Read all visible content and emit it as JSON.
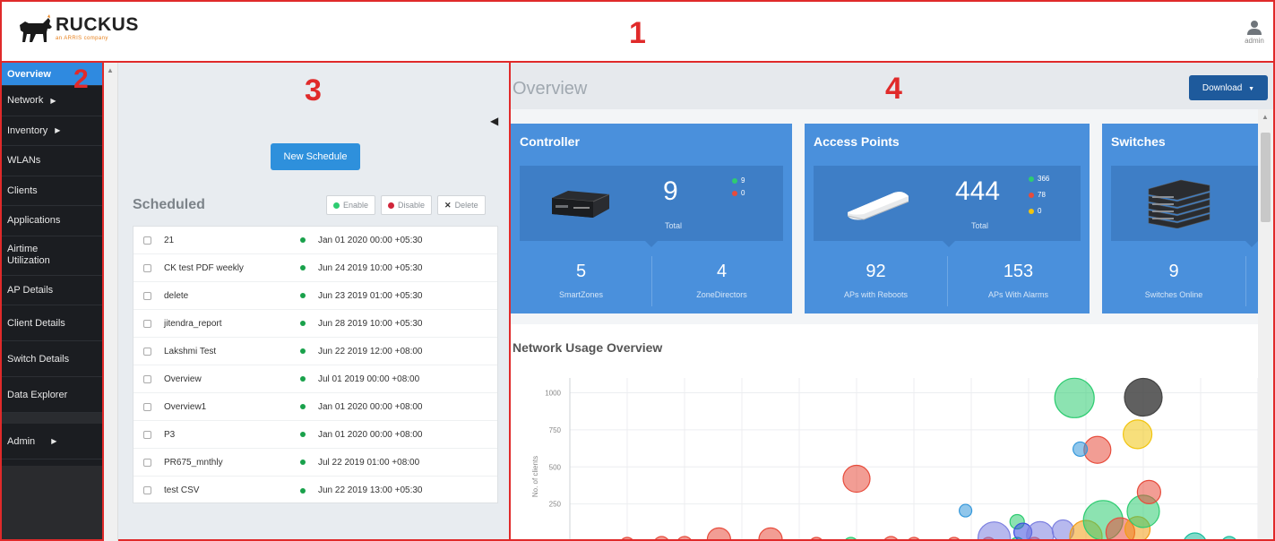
{
  "header": {
    "brand": "RUCKUS",
    "brand_sub": "an ARRIS company",
    "region_label": "1",
    "user_label": "admin"
  },
  "sidebar": {
    "region_label": "2",
    "items": [
      {
        "label": "Overview",
        "active": true
      },
      {
        "label": "Network",
        "has_submenu": true
      },
      {
        "label": "Inventory",
        "has_submenu": true
      },
      {
        "label": "WLANs"
      },
      {
        "label": "Clients"
      },
      {
        "label": "Applications"
      },
      {
        "label": "Airtime Utilization"
      },
      {
        "label": "AP Details"
      },
      {
        "label": "Client Details"
      },
      {
        "label": "Switch Details"
      },
      {
        "label": "Data Explorer"
      },
      {
        "label": "Admin",
        "has_submenu": true
      }
    ]
  },
  "schedules": {
    "region_label": "3",
    "new_schedule_label": "New Schedule",
    "title": "Scheduled",
    "actions": {
      "enable": "Enable",
      "disable": "Disable",
      "delete": "Delete"
    },
    "rows": [
      {
        "name": "21",
        "time": "Jan 01 2020 00:00 +05:30"
      },
      {
        "name": "CK test PDF weekly",
        "time": "Jun 24 2019 10:00 +05:30"
      },
      {
        "name": "delete",
        "time": "Jun 23 2019 01:00 +05:30"
      },
      {
        "name": "jitendra_report",
        "time": "Jun 28 2019 10:00 +05:30"
      },
      {
        "name": "Lakshmi Test",
        "time": "Jun 22 2019 12:00 +08:00"
      },
      {
        "name": "Overview",
        "time": "Jul 01 2019 00:00 +08:00"
      },
      {
        "name": "Overview1",
        "time": "Jan 01 2020 00:00 +08:00"
      },
      {
        "name": "P3",
        "time": "Jan 01 2020 00:00 +08:00"
      },
      {
        "name": "PR675_mnthly",
        "time": "Jul 22 2019 01:00 +08:00"
      },
      {
        "name": "test CSV",
        "time": "Jun 22 2019 13:00 +05:30"
      }
    ]
  },
  "overview": {
    "region_label": "4",
    "title": "Overview",
    "download_label": "Download",
    "controller": {
      "title": "Controller",
      "total": "9",
      "total_label": "Total",
      "up": "9",
      "down": "0",
      "stats": [
        {
          "value": "5",
          "label": "SmartZones"
        },
        {
          "value": "4",
          "label": "ZoneDirectors"
        }
      ]
    },
    "access_points": {
      "title": "Access Points",
      "total": "444",
      "total_label": "Total",
      "up": "366",
      "down": "78",
      "flagged": "0",
      "stats": [
        {
          "value": "92",
          "label": "APs with Reboots"
        },
        {
          "value": "153",
          "label": "APs With Alarms"
        }
      ]
    },
    "switches": {
      "title": "Switches",
      "stats": [
        {
          "value": "9",
          "label": "Switches Online"
        }
      ]
    },
    "colors": {
      "green": "#2ecc71",
      "red": "#e74c3c",
      "yellow": "#f1c40f",
      "card": "#4a90dc"
    }
  },
  "chart_data": {
    "type": "scatter",
    "title": "Network Usage Overview",
    "ylabel": "No. of clients",
    "yticks": [
      250,
      500,
      750,
      1000
    ],
    "ylim": [
      0,
      1100
    ],
    "points": [
      {
        "x": 0.1,
        "y": 0,
        "r": 8,
        "color": "#e74c3c"
      },
      {
        "x": 0.16,
        "y": 0,
        "r": 9,
        "color": "#e74c3c"
      },
      {
        "x": 0.2,
        "y": 0,
        "r": 9,
        "color": "#e74c3c"
      },
      {
        "x": 0.26,
        "y": 10,
        "r": 13,
        "color": "#e74c3c"
      },
      {
        "x": 0.35,
        "y": 10,
        "r": 13,
        "color": "#e74c3c"
      },
      {
        "x": 0.43,
        "y": 0,
        "r": 8,
        "color": "#e74c3c"
      },
      {
        "x": 0.49,
        "y": 0,
        "r": 8,
        "color": "#2ecc71"
      },
      {
        "x": 0.56,
        "y": 0,
        "r": 9,
        "color": "#e74c3c"
      },
      {
        "x": 0.6,
        "y": 0,
        "r": 8,
        "color": "#e74c3c"
      },
      {
        "x": 0.67,
        "y": 0,
        "r": 8,
        "color": "#e74c3c"
      },
      {
        "x": 0.73,
        "y": 0,
        "r": 8,
        "color": "#e74c3c"
      },
      {
        "x": 0.78,
        "y": 0,
        "r": 8,
        "color": "#2ecc71"
      },
      {
        "x": 0.81,
        "y": 0,
        "r": 8,
        "color": "#e74c3c"
      },
      {
        "x": 0.5,
        "y": 420,
        "r": 15,
        "color": "#e74c3c"
      },
      {
        "x": 0.69,
        "y": 205,
        "r": 7,
        "color": "#3498db"
      },
      {
        "x": 0.78,
        "y": 130,
        "r": 8,
        "color": "#2ecc71"
      },
      {
        "x": 0.74,
        "y": 20,
        "r": 18,
        "color": "#7b7fe0"
      },
      {
        "x": 0.79,
        "y": 60,
        "r": 10,
        "color": "#3a4ce0"
      },
      {
        "x": 0.82,
        "y": 40,
        "r": 15,
        "color": "#7b7fe0"
      },
      {
        "x": 0.86,
        "y": 70,
        "r": 12,
        "color": "#7b7fe0"
      },
      {
        "x": 0.9,
        "y": 30,
        "r": 18,
        "color": "#f39c12"
      },
      {
        "x": 0.93,
        "y": 140,
        "r": 22,
        "color": "#2ecc71"
      },
      {
        "x": 0.96,
        "y": 60,
        "r": 16,
        "color": "#e74c3c"
      },
      {
        "x": 0.99,
        "y": 80,
        "r": 14,
        "color": "#f39c12"
      },
      {
        "x": 1.0,
        "y": 200,
        "r": 18,
        "color": "#2ecc71"
      },
      {
        "x": 1.01,
        "y": 330,
        "r": 13,
        "color": "#e74c3c"
      },
      {
        "x": 0.88,
        "y": 965,
        "r": 22,
        "color": "#2ecc71"
      },
      {
        "x": 1.0,
        "y": 970,
        "r": 21,
        "color": "#444444"
      },
      {
        "x": 0.99,
        "y": 720,
        "r": 16,
        "color": "#f1c40f"
      },
      {
        "x": 0.92,
        "y": 615,
        "r": 15,
        "color": "#e74c3c"
      },
      {
        "x": 0.89,
        "y": 620,
        "r": 8,
        "color": "#3498db"
      },
      {
        "x": 1.09,
        "y": 0,
        "r": 13,
        "color": "#1abc9c"
      },
      {
        "x": 1.15,
        "y": 0,
        "r": 9,
        "color": "#1abc9c"
      }
    ]
  }
}
